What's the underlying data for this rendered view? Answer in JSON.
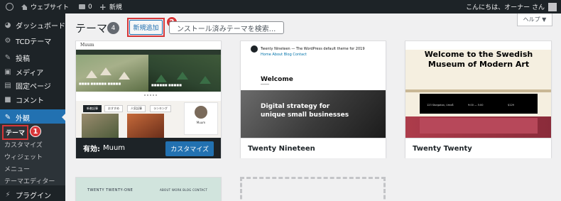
{
  "admin_bar": {
    "site_name": "ウェブサイト",
    "comments_count": "0",
    "new_label": "新規",
    "greeting": "こんにちは、オーナー さん"
  },
  "sidebar": {
    "items": [
      {
        "label": "ダッシュボード",
        "icon": "dashboard-icon"
      },
      {
        "label": "TCDテーマ",
        "icon": "tcd-icon"
      },
      {
        "label": "投稿",
        "icon": "pin-icon"
      },
      {
        "label": "メディア",
        "icon": "media-icon"
      },
      {
        "label": "固定ページ",
        "icon": "page-icon"
      },
      {
        "label": "コメント",
        "icon": "comment-icon"
      },
      {
        "label": "外観",
        "icon": "appearance-icon"
      },
      {
        "label": "プラグイン",
        "icon": "plugin-icon"
      }
    ],
    "submenu": [
      "テーマ",
      "カスタマイズ",
      "ウィジェット",
      "メニュー",
      "テーマエディター"
    ],
    "annotation_1": "1"
  },
  "header": {
    "title": "テーマ",
    "count": "4",
    "add_new_label": "新規追加",
    "annotation_2": "2",
    "search_placeholder": "ンストール済みテーマを検索...",
    "help_label": "ヘルプ ▼"
  },
  "themes": [
    {
      "name": "Muum",
      "active_prefix": "有効:",
      "customize_label": "カスタマイズ",
      "preview": {
        "logo": "Muum",
        "tabs": [
          "新着記事",
          "おすすめ",
          "人気記事",
          "ランキング"
        ],
        "profile_name": "Muum"
      }
    },
    {
      "name": "Twenty Nineteen",
      "preview": {
        "site_title": "Twenty Nineteen — The WordPress default theme for 2019",
        "nav": "Home  About  Blog  Contact",
        "welcome": "Welcome",
        "headline_1": "Digital strategy for",
        "headline_2": "unique small businesses"
      }
    },
    {
      "name": "Twenty Twenty",
      "preview": {
        "title_1": "Welcome to the Swedish",
        "title_2": "Museum of Modern Art",
        "address": "123 Storgatan, Umeå",
        "hours": "9:00 — 5:00",
        "price": "$129"
      }
    },
    {
      "name": "",
      "preview": {
        "site_name": "TWENTY TWENTY-ONE",
        "nav": "ABOUT   WORK   BLOG   CONTACT"
      }
    }
  ],
  "colors": {
    "admin_dark": "#1d2327",
    "accent_blue": "#2271b1",
    "annotation_red": "#d63638"
  }
}
